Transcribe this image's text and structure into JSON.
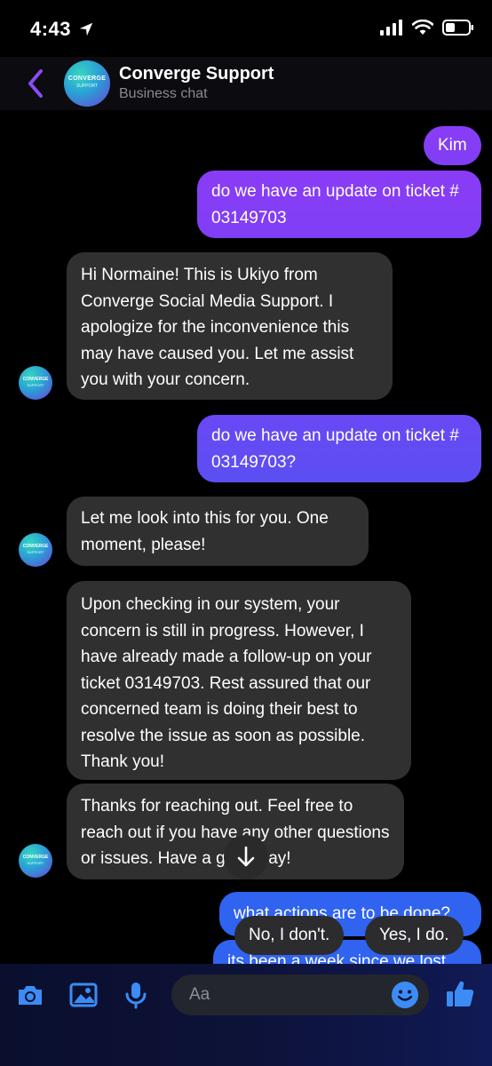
{
  "status": {
    "time": "4:43"
  },
  "header": {
    "name": "Converge Support",
    "subtitle": "Business chat",
    "logo_text": "CONVERGE",
    "logo_sub": "SUPPORT"
  },
  "messages": [
    {
      "side": "out",
      "text": "Kim"
    },
    {
      "side": "out",
      "text": "do we have an update on ticket # 03149703"
    },
    {
      "side": "in",
      "text": "Hi Normaine! This is Ukiyo from Converge Social Media Support. I apologize for the inconvenience this may have caused you. Let me assist you with your concern."
    },
    {
      "side": "out",
      "text": "do we have an update on ticket # 03149703?"
    },
    {
      "side": "in",
      "text": "Let me look into this for you. One moment, please!"
    },
    {
      "side": "in",
      "text": "Upon checking in our system, your concern is still in progress. However, I have already made a follow-up on your ticket 03149703. Rest assured that our concerned team is doing their best to resolve the issue as soon as possible. Thank you!"
    },
    {
      "side": "in",
      "text": "Thanks for reaching out. Feel free to reach out if you have any other questions or issues. Have a great day!"
    },
    {
      "side": "out",
      "text": "what actions are to be done?"
    },
    {
      "side": "out",
      "text": "its been a week since we lost"
    }
  ],
  "quick_replies": [
    "No, I don't.",
    "Yes, I do."
  ],
  "composer": {
    "placeholder": "Aa"
  },
  "colors": {
    "accent_purple": "#8a3cf6",
    "accent_blue": "#2f63f0",
    "incoming": "#303030"
  }
}
